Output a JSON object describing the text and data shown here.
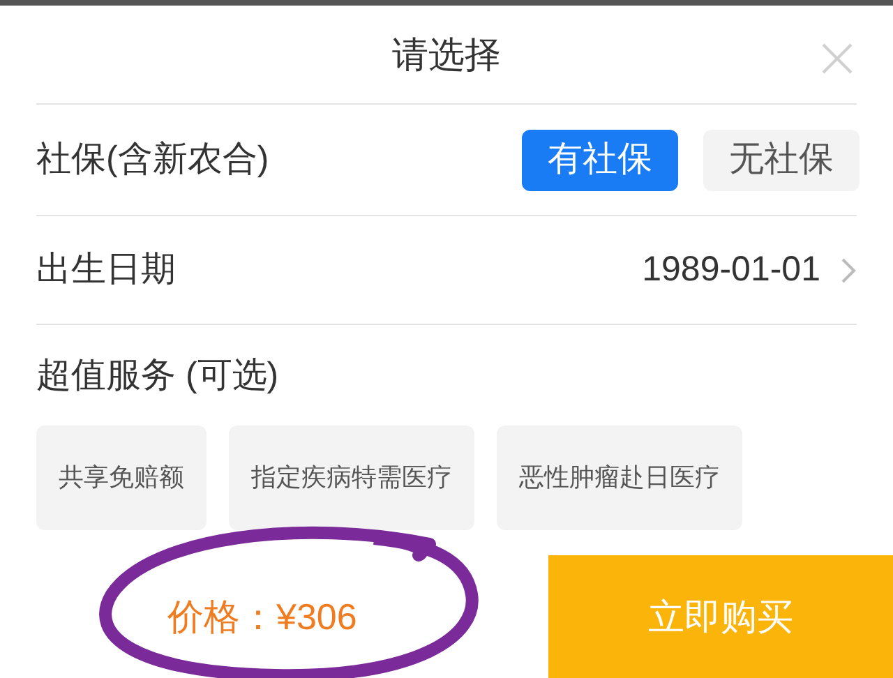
{
  "dialog": {
    "title": "请选择"
  },
  "social_security": {
    "label": "社保(含新农合)",
    "options": [
      {
        "label": "有社保",
        "selected": true
      },
      {
        "label": "无社保",
        "selected": false
      }
    ]
  },
  "birth_date": {
    "label": "出生日期",
    "value": "1989-01-01"
  },
  "services": {
    "label": "超值服务 (可选)",
    "options": [
      {
        "label": "共享免赔额",
        "selected": false
      },
      {
        "label": "指定疾病特需医疗",
        "selected": false
      },
      {
        "label": "恶性肿瘤赴日医疗",
        "selected": false
      }
    ]
  },
  "footer": {
    "price": "价格：¥306",
    "buy_button": "立即购买"
  }
}
